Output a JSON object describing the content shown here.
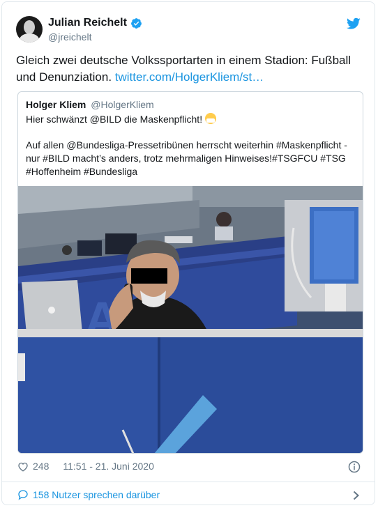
{
  "author": {
    "name": "Julian Reichelt",
    "handle": "@jreichelt"
  },
  "tweet": {
    "text": "Gleich zwei deutsche Volkssportarten in einem Stadion: Fußball und Denunziation.",
    "link": "twitter.com/HolgerKliem/st…"
  },
  "quote": {
    "name": "Holger Kliem",
    "handle": "@HolgerKliem",
    "line1": "Hier schwänzt @BILD die Maskenpflicht!",
    "line2": "Auf allen @Bundesliga-Pressetribünen herrscht weiterhin #Maskenpflicht - nur #BILD macht’s anders, trotz mehrmaligen Hinweises!#TSGFCU #TSG #Hoffenheim #Bundesliga"
  },
  "meta": {
    "likes": "248",
    "timestamp": "11:51 - 21. Juni 2020"
  },
  "footer": {
    "discussion": "158 Nutzer sprechen darüber"
  },
  "icons": [
    "verified-badge-icon",
    "twitter-bird-icon",
    "mask-emoji-icon",
    "heart-icon",
    "info-icon",
    "chat-bubble-icon",
    "chevron-right-icon"
  ],
  "colors": {
    "accent": "#1b95e0",
    "muted": "#657786",
    "text": "#14171a",
    "border": "#e1e8ed"
  }
}
